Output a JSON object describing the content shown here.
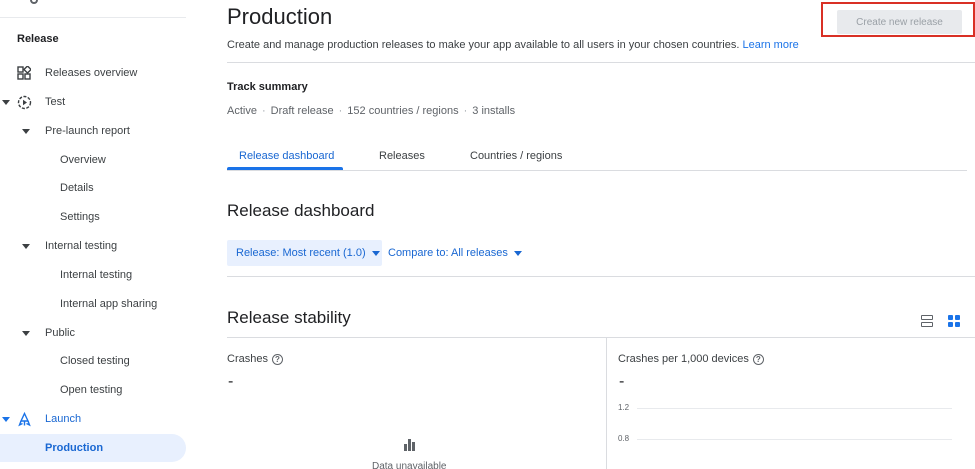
{
  "sidebar": {
    "section_title": "Release",
    "items": {
      "releases_overview": "Releases overview",
      "test": "Test",
      "pre_launch_report": "Pre-launch report",
      "overview": "Overview",
      "details": "Details",
      "settings": "Settings",
      "internal_testing_group": "Internal testing",
      "internal_testing": "Internal testing",
      "internal_app_sharing": "Internal app sharing",
      "public": "Public",
      "closed_testing": "Closed testing",
      "open_testing": "Open testing",
      "launch": "Launch",
      "production": "Production"
    }
  },
  "header": {
    "title": "Production",
    "description": "Create and manage production releases to make your app available to all users in your chosen countries.",
    "learn_more": "Learn more",
    "create_button": "Create new release"
  },
  "track_summary": {
    "title": "Track summary",
    "status": "Active",
    "release": "Draft release",
    "countries": "152 countries / regions",
    "installs": "3 installs",
    "separator": "·"
  },
  "tabs": {
    "release_dashboard": "Release dashboard",
    "releases": "Releases",
    "countries": "Countries / regions"
  },
  "dashboard": {
    "title": "Release dashboard",
    "release_filter": "Release: Most recent (1.0)",
    "compare_filter": "Compare to: All releases"
  },
  "stability": {
    "title": "Release stability",
    "crashes_label": "Crashes",
    "crashes_value": "-",
    "crashes_per_label": "Crashes per 1,000 devices",
    "crashes_per_value": "-",
    "data_unavailable": "Data unavailable",
    "y_ticks": [
      "1.2",
      "0.8"
    ]
  },
  "colors": {
    "accent": "#1a73e8",
    "highlight_box": "#d93025"
  }
}
